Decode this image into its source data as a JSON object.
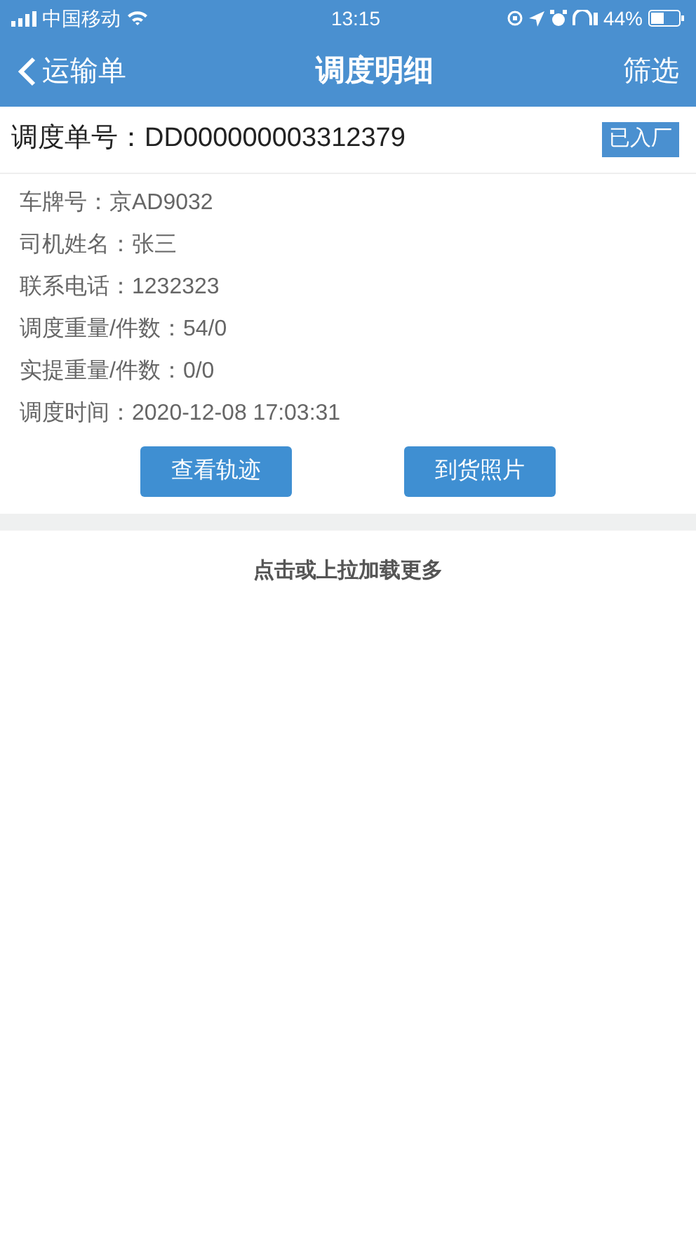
{
  "status_bar": {
    "carrier": "中国移动",
    "time": "13:15",
    "battery": "44%"
  },
  "nav_bar": {
    "back": "运输单",
    "title": "调度明细",
    "action": "筛选"
  },
  "order": {
    "number": "调度单号：DD000000003312379",
    "status": "已入厂",
    "details": [
      "车牌号：京AD9032",
      "司机姓名：张三",
      "联系电话：1232323",
      "调度重量/件数：54/0",
      "实提重量/件数：0/0",
      "调度时间：2020-12-08 17:03:31"
    ],
    "buttons": [
      "查看轨迹",
      "到货照片"
    ]
  },
  "load_more": "点击或上拉加载更多"
}
